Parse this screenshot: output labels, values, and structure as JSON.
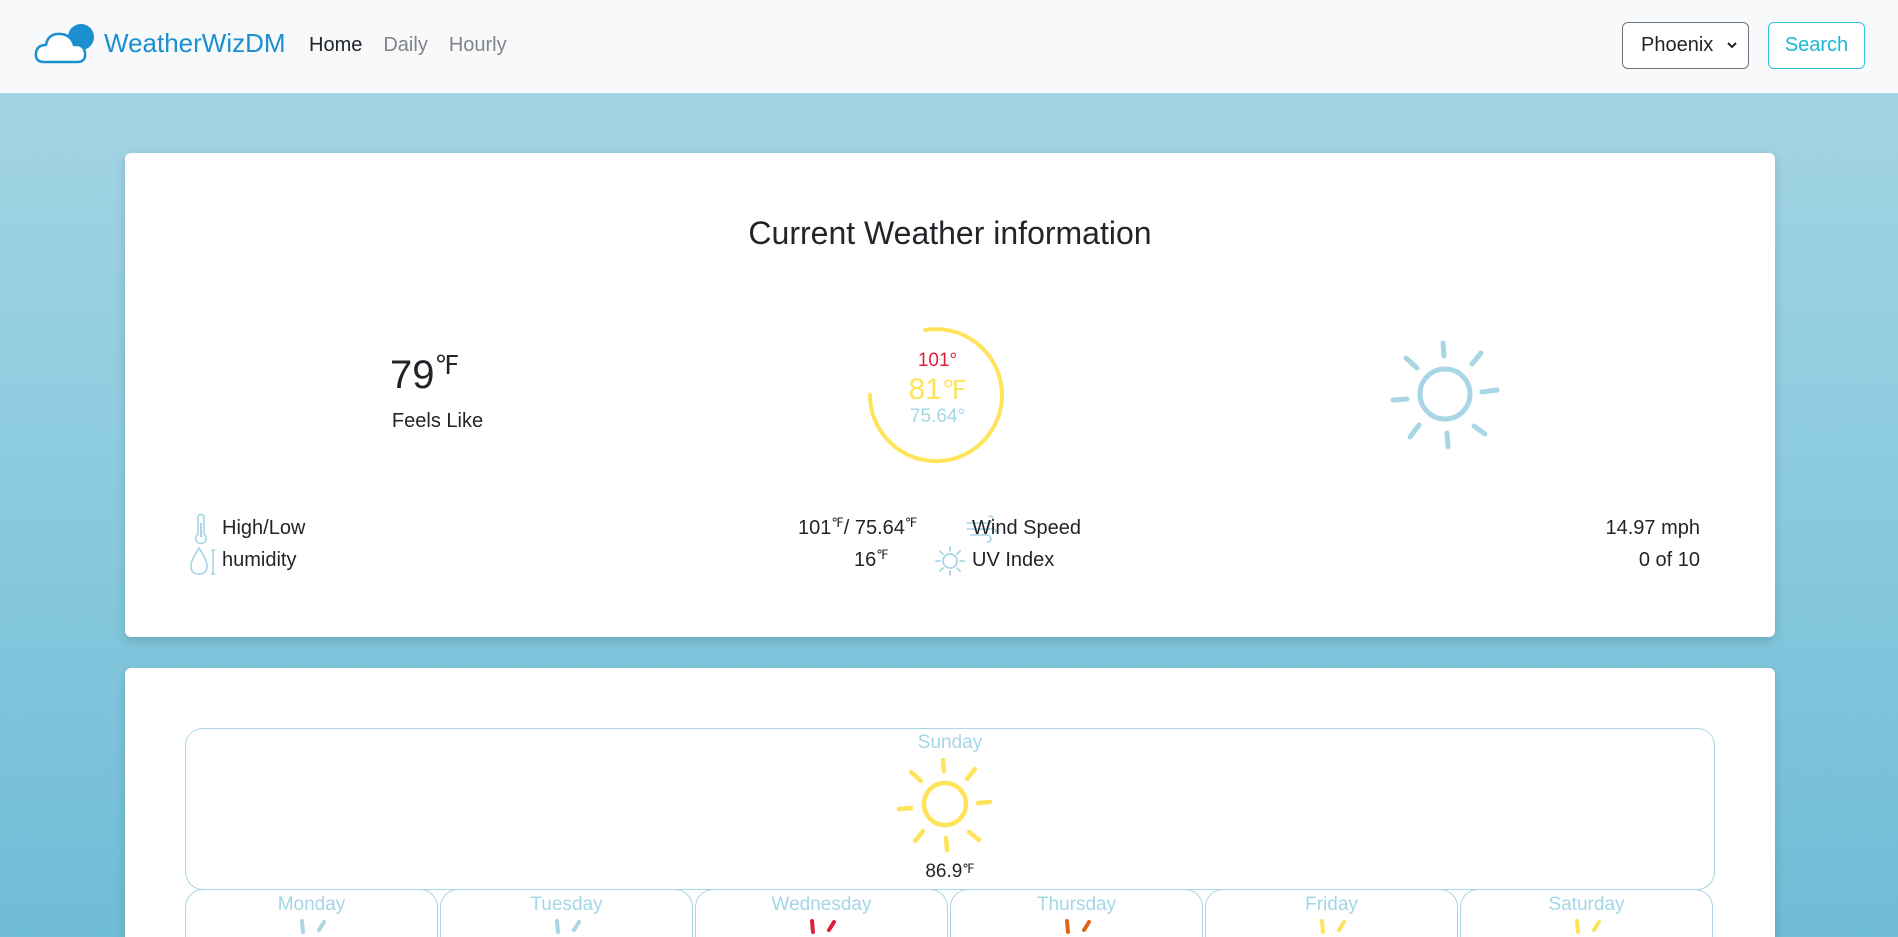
{
  "navbar": {
    "brand": "WeatherWizDM",
    "links": [
      "Home",
      "Daily",
      "Hourly"
    ],
    "city_selected": "Phoenix",
    "search_label": "Search"
  },
  "current": {
    "title": "Current Weather information",
    "feels_like_value": "79",
    "feels_like_unit": "℉",
    "feels_like_label": "Feels Like",
    "gauge_high": "101°",
    "gauge_current": "81",
    "gauge_unit": "℉",
    "gauge_low": "75.64°",
    "condition_icon": "sun-icon",
    "details": {
      "high_low_label": "High/Low",
      "high_value": "101",
      "low_value": "/ 75.64",
      "unit": "℉",
      "humidity_label": "humidity",
      "humidity_value": "16",
      "wind_label": "Wind Speed",
      "wind_value": "14.97 mph",
      "uv_label": "UV Index",
      "uv_value": "0 of 10"
    }
  },
  "forecast": {
    "today": {
      "name": "Sunday",
      "temp": "86.9",
      "unit": "℉",
      "icon": "sun-icon"
    },
    "days": [
      {
        "name": "Monday",
        "color": "#a8d6e5"
      },
      {
        "name": "Tuesday",
        "color": "#a8d6e5"
      },
      {
        "name": "Wednesday",
        "color": "#dc1f3c"
      },
      {
        "name": "Thursday",
        "color": "#e0641a"
      },
      {
        "name": "Friday",
        "color": "#ffe35b"
      },
      {
        "name": "Saturday",
        "color": "#ffe35b"
      }
    ]
  },
  "colors": {
    "brand": "#1b8fcf",
    "search_accent": "#19b8d6",
    "high": "#dc1f3c",
    "current": "#ffe35b",
    "low": "#a5d6e6"
  }
}
